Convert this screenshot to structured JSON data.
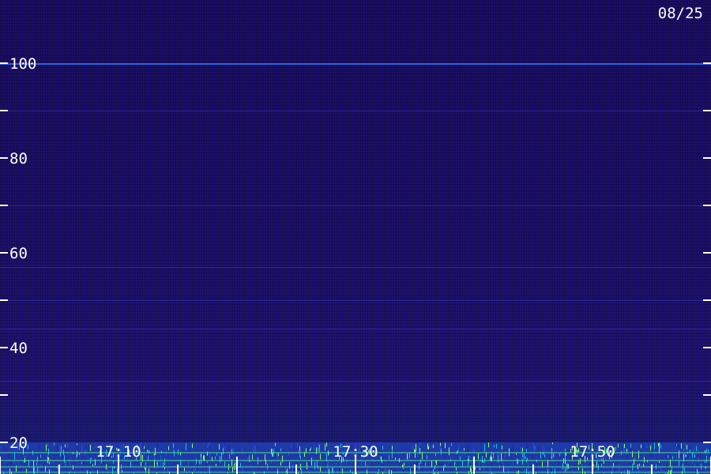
{
  "date_label": "08/25",
  "chart_data": {
    "type": "heatmap",
    "title": "",
    "xlabel": "",
    "ylabel": "",
    "y_ticks": [
      "100",
      "80",
      "60",
      "40",
      "20"
    ],
    "x_ticks": [
      "17:10",
      "17:30",
      "17:50"
    ],
    "ylim": [
      15,
      105
    ],
    "x_range_minutes": [
      "17:00",
      "18:00"
    ],
    "colormap": [
      "#000000",
      "#1a0a5c",
      "#2a1fa0",
      "#1f58d8",
      "#22c0e0",
      "#8cff6a"
    ],
    "intensity_description_bands": [
      {
        "y_from": 15,
        "y_to": 20,
        "level": "high"
      },
      {
        "y_from": 20,
        "y_to": 105,
        "level": "low"
      }
    ]
  }
}
